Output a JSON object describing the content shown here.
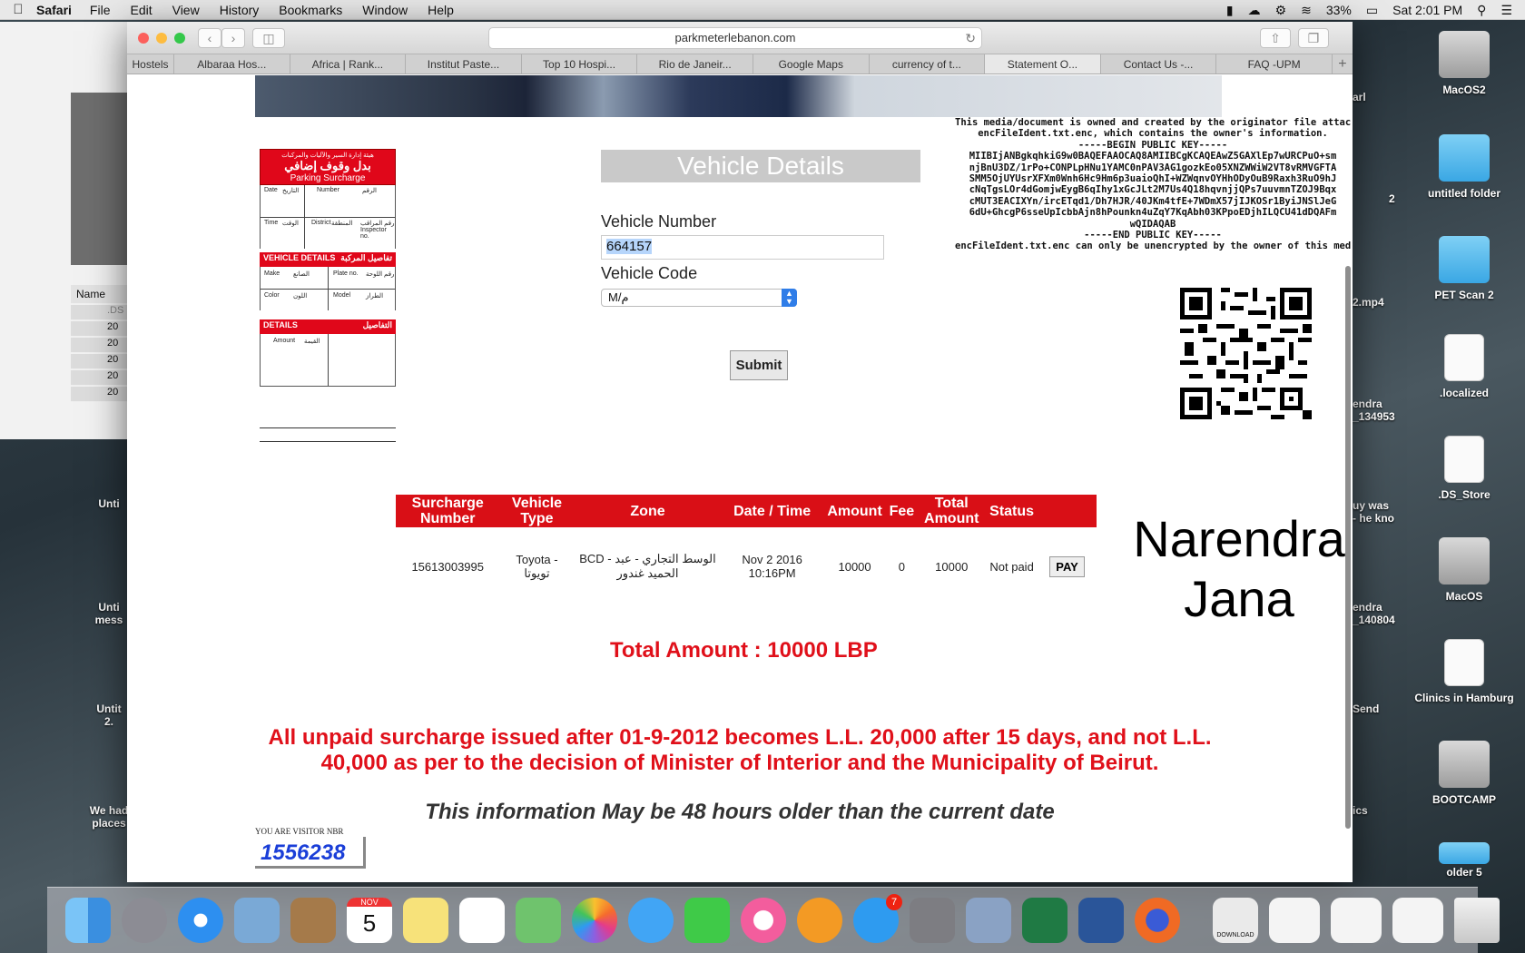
{
  "menubar": {
    "app": "Safari",
    "items": [
      "File",
      "Edit",
      "View",
      "History",
      "Bookmarks",
      "Window",
      "Help"
    ],
    "battery": "33%",
    "clock": "Sat 2:01 PM"
  },
  "desktop": {
    "left_finder": {
      "column_header": "Name",
      "rows": [
        ".DS",
        "20",
        "20",
        "20",
        "20",
        "20"
      ]
    },
    "left_icons": [
      "Unti",
      "Unti\nmess",
      "Untit\n2.",
      "We had\nplaces"
    ],
    "right_icons": [
      {
        "label": "MacOS2",
        "kind": "disk"
      },
      {
        "label": "untitled folder",
        "kind": "folder"
      },
      {
        "label": "PET Scan 2",
        "kind": "folder"
      },
      {
        "label": ".localized",
        "kind": "doc"
      },
      {
        "label": ".DS_Store",
        "kind": "doc"
      },
      {
        "label": "MacOS",
        "kind": "disk"
      },
      {
        "label": "Clinics in Hamburg",
        "kind": "doc"
      },
      {
        "label": "BOOTCAMP",
        "kind": "disk"
      },
      {
        "label": "older 5",
        "kind": "folder"
      }
    ],
    "mid_labels": [
      "arl",
      "2",
      "2.mp4",
      "endra\n_134953",
      "uy was\n- he kno",
      "endra\n_140804",
      "Send",
      "ics"
    ]
  },
  "browser": {
    "url": "parkmeterlebanon.com",
    "tabs": [
      "Hostels",
      "Albaraa Hos...",
      "Africa | Rank...",
      "Institut Paste...",
      "Top 10 Hospi...",
      "Rio de Janeir...",
      "Google Maps",
      "currency of t...",
      "Statement O...",
      "Contact Us -...",
      "FAQ -UPM"
    ],
    "active_tab": 8
  },
  "page": {
    "ticket": {
      "title_ar": "بدل وقوف إضافي",
      "title_en": "Parking Surcharge",
      "org_ar": "هيئة إدارة السير والآليات والمركبات",
      "fields": [
        "Date",
        "التاريخ",
        "Number",
        "الرقم",
        "Time",
        "الوقت",
        "District",
        "المنطقة",
        "رقم المراقب",
        "Inspector no."
      ],
      "vehicle_details": "VEHICLE DETAILS",
      "vehicle_details_ar": "تفاصيل المركبة",
      "vehicle_fields": [
        "Make",
        "الصانع",
        "Plate no.",
        "رقم اللوحة",
        "Color",
        "اللون",
        "Model",
        "الطراز"
      ],
      "details": "DETAILS",
      "details_ar": "التفاصيل",
      "amount": "Amount",
      "amount_ar": "القيمة"
    },
    "vehicle_details_title": "Vehicle Details",
    "vehicle_number_label": "Vehicle Number",
    "vehicle_number_value": "664157",
    "vehicle_code_label": "Vehicle Code",
    "vehicle_code_value": "M/م",
    "submit_label": "Submit",
    "public_key_text": "This media/document is owned and created by the originator file attached to this file,\nencFileIdent.txt.enc, which contains the owner's information.\n-----BEGIN PUBLIC KEY-----\nMIIBIjANBgkqhkiG9w0BAQEFAAOCAQ8AMIIBCgKCAQEAwZ5GAXlEp7wURCPuO+sm\nnjBnU3DZ/1rPo+CONPLpHNu1YAMC0nPAV3AG1gozkEo05XNZWWiW2VT8vRMVGFTA\nSMM5OjUYUsrXFXm0Wnh6Hc9Hm6p3uaioQhI+WZWqnvOYHhODyOuB9Raxh3RuO9hJ\ncNqTgsLOr4dGomjwEygB6qIhy1xGcJLt2M7Us4Q18hqvnjjQPs7uuvmnTZOJ9Bqx\ncMUT3EACIXYn/ircETqd1/Dh7HJR/40JKm4tfE+7WDmX57jIJKOSr1ByiJNSlJeG\n6dU+GhcgP6sseUpIcbbAjn8hPounkn4uZqY7KqAbh03KPpoEDjhILQCU41dDQAFm\nwQIDAQAB\n-----END PUBLIC KEY-----\nencFileIdent.txt.enc can only be unencrypted by the owner of this media.",
    "table": {
      "headers": [
        "Surcharge Number",
        "Vehicle Type",
        "Zone",
        "Date / Time",
        "Amount",
        "Fee",
        "Total Amount",
        "Status",
        ""
      ],
      "row": {
        "surcharge_number": "15613003995",
        "vehicle_type": "Toyota - تويوتا",
        "zone": "BCD - الوسط التجاري - عبد الحميد غندور",
        "date_time": "Nov 2 2016 10:16PM",
        "amount": "10000",
        "fee": "0",
        "total_amount": "10000",
        "status": "Not paid",
        "pay_label": "PAY"
      }
    },
    "owner_name": "Narendra Jana",
    "total_amount_text": "Total Amount : 10000 LBP",
    "notice_text": "All unpaid surcharge issued after 01-9-2012 becomes L.L. 20,000 after 15 days, and not L.L. 40,000 as per to the decision of Minister of Interior and the Municipality of Beirut.",
    "info_text": "This information May be 48 hours older than the current date",
    "visitor_label": "YOU ARE VISITOR NBR",
    "visitor_number": "1556238"
  },
  "dock": {
    "apps": [
      "Finder",
      "Launchpad",
      "Safari",
      "Preview",
      "Contacts",
      "Calendar",
      "Notes",
      "Reminders",
      "Maps",
      "Photos",
      "Messages",
      "FaceTime",
      "iTunes",
      "iBooks",
      "App Store",
      "System Preferences",
      "Directory Utility",
      "Excel",
      "Word",
      "Firefox"
    ],
    "calendar_month": "NOV",
    "calendar_day": "5",
    "appstore_badge": "7",
    "download_label": "DOWNLOAD",
    "colors": {
      "finder": "#3aa2f0",
      "launchpad": "#8c8c94",
      "safari": "#2d8ff0",
      "preview": "#7aa9d6",
      "contacts": "#a57a4a",
      "calendar": "#ffffff",
      "notes": "#f7e27a",
      "reminders": "#ffffff",
      "maps": "#6fc36d",
      "photos": "#ffffff",
      "messages": "#41a5f5",
      "facetime": "#3fca48",
      "itunes": "#f35d9d",
      "ibooks": "#f39a24",
      "appstore": "#2e9bf0",
      "sysprefs": "#7d7d82",
      "directory": "#8aa2c4",
      "excel": "#1f7a44",
      "word": "#2a5599",
      "firefox": "#f06a24"
    }
  },
  "colors": {
    "accent_red": "#e0101a",
    "table_header_red": "#d90f16",
    "visitor_blue": "#1a3ed8"
  }
}
